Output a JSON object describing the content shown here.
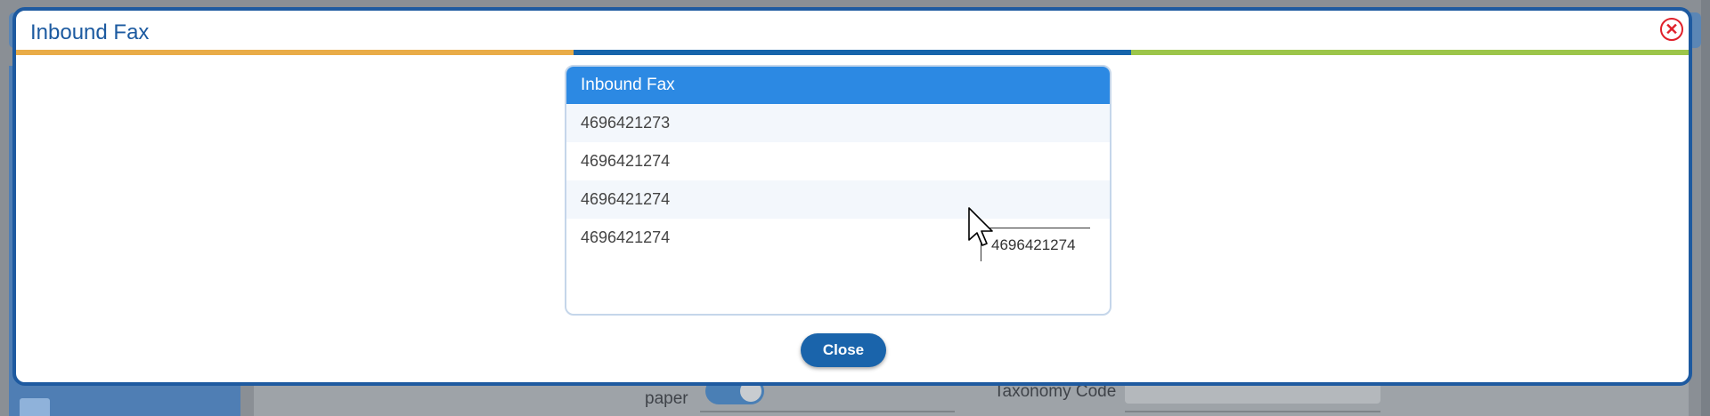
{
  "background": {
    "paper_label": "paper",
    "taxonomy_label": "Taxonomy Code"
  },
  "modal": {
    "title": "Inbound Fax",
    "close_icon": "close-circle-icon",
    "color_bar": [
      "#e9ac48",
      "#1664ab",
      "#9cc54a"
    ]
  },
  "list": {
    "header": "Inbound Fax",
    "rows": [
      "4696421273",
      "4696421274",
      "4696421274",
      "4696421274"
    ]
  },
  "tooltip": {
    "text": "4696421274"
  },
  "footer": {
    "close_label": "Close"
  }
}
